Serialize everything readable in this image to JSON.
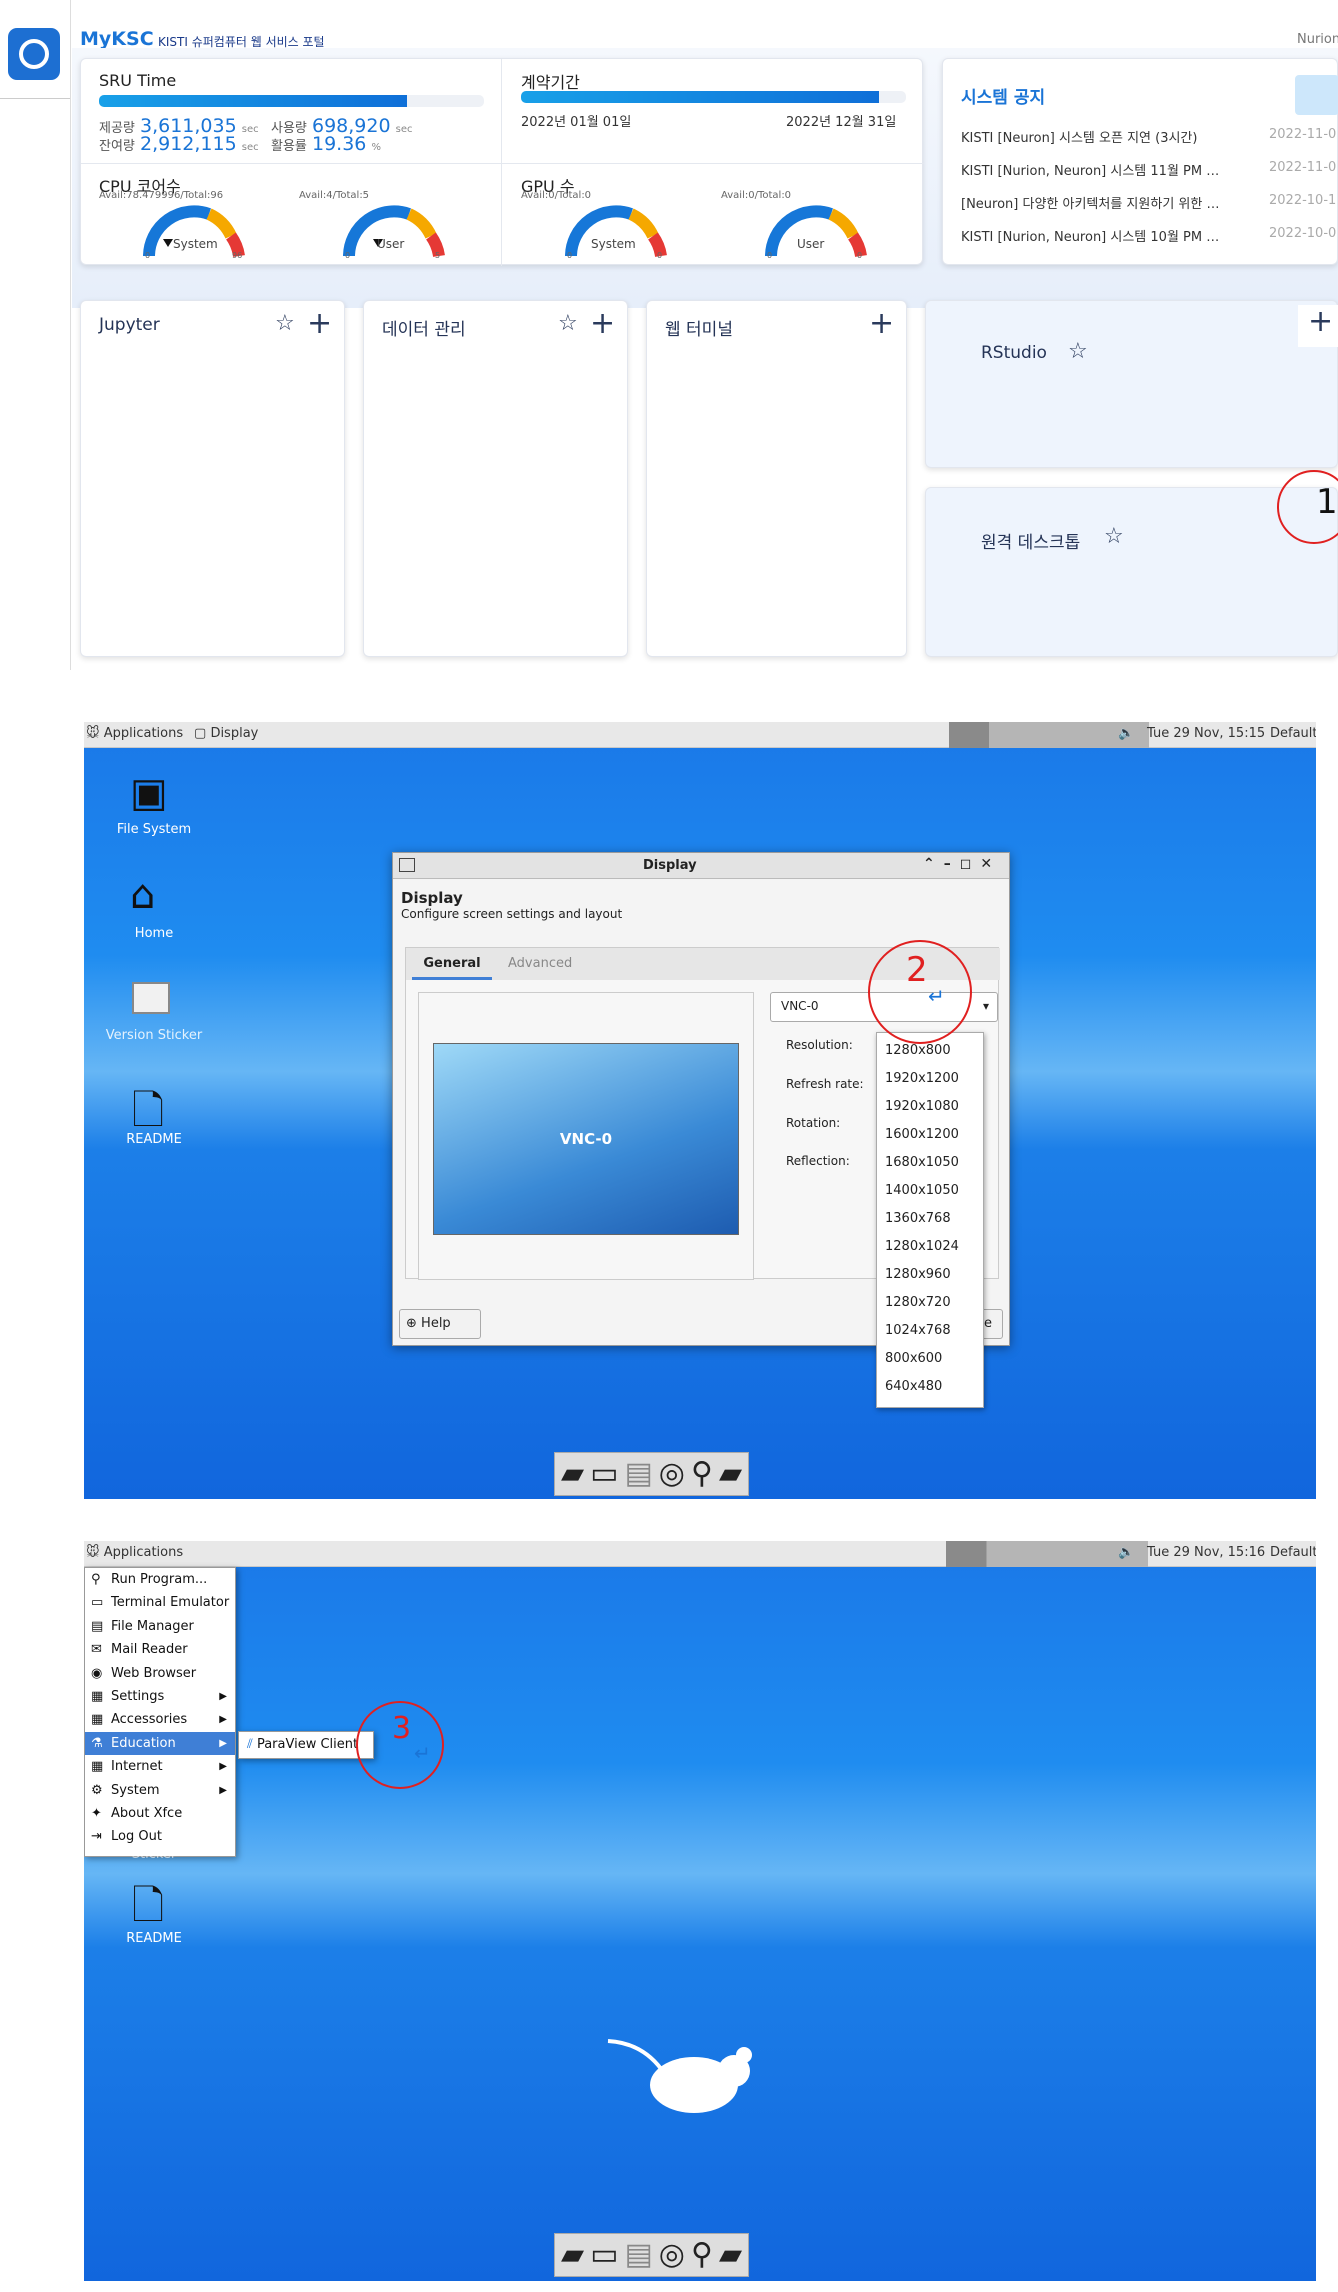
{
  "portal": {
    "brand": "MyKSC",
    "subtitle": "KISTI 슈퍼컴퓨터 웹 서비스 포털",
    "top_right": "Nurion",
    "sru": {
      "title": "SRU Time",
      "progress": 0.8,
      "provided_label": "제공량",
      "provided_value": "3,611,035",
      "provided_unit": "sec",
      "used_label": "사용량",
      "used_value": "698,920",
      "used_unit": "sec",
      "remain_label": "잔여량",
      "remain_value": "2,912,115",
      "remain_unit": "sec",
      "rate_label": "활용률",
      "rate_value": "19.36",
      "rate_unit": "%"
    },
    "contract": {
      "title": "계약기간",
      "progress": 0.93,
      "start": "2022년 01월 01일",
      "end": "2022년 12월 31일"
    },
    "cpu": {
      "title": "CPU 코어수",
      "system_avail": "Avail:78.479996/Total:96",
      "system_label": "System",
      "system_min": "0",
      "system_max": "96",
      "user_avail": "Avail:4/Total:5",
      "user_label": "User",
      "user_min": "0",
      "user_max": "5"
    },
    "gpu": {
      "title": "GPU 수",
      "system_avail": "Avail:0/Total:0",
      "system_label": "System",
      "system_min": "0",
      "system_max": "0",
      "user_avail": "Avail:0/Total:0",
      "user_label": "User",
      "user_min": "0",
      "user_max": "0"
    },
    "notice": {
      "title": "시스템 공지",
      "items": [
        {
          "text": "KISTI [Neuron] 시스템 오픈 지연 (3시간)",
          "date": "2022-11-0"
        },
        {
          "text": "KISTI [Nurion, Neuron] 시스템 11월 PM …",
          "date": "2022-11-0"
        },
        {
          "text": "[Neuron] 다양한 아키텍처를 지원하기 위한 …",
          "date": "2022-10-1"
        },
        {
          "text": "KISTI [Nurion, Neuron] 시스템 10월 PM …",
          "date": "2022-10-0"
        }
      ]
    },
    "apps": {
      "jupyter": "Jupyter",
      "data": "데이터 관리",
      "terminal": "웹 터미널",
      "rstudio": "RStudio",
      "remote": "원격 데스크톱"
    },
    "step1": "1"
  },
  "desktop1": {
    "applications": "Applications",
    "window_tab": "Display",
    "clock": "Tue 29 Nov, 15:15",
    "default": "Default",
    "icons": {
      "filesystem": "File System",
      "home": "Home",
      "version_sticker": "Version Sticker",
      "readme": "README"
    },
    "dialog": {
      "title": "Display",
      "heading": "Display",
      "description": "Configure screen settings and layout",
      "tab_general": "General",
      "tab_advanced": "Advanced",
      "monitor_name": "VNC-0",
      "select_value": "VNC-0",
      "resolution_label": "Resolution:",
      "refresh_label": "Refresh rate:",
      "rotation_label": "Rotation:",
      "reflection_label": "Reflection:",
      "help": "Help",
      "close_fragment": "e",
      "resolutions": [
        "1280x800",
        "1920x1200",
        "1920x1080",
        "1600x1200",
        "1680x1050",
        "1400x1050",
        "1360x768",
        "1280x1024",
        "1280x960",
        "1280x720",
        "1024x768",
        "800x600",
        "640x480"
      ]
    },
    "step2": "2"
  },
  "desktop2": {
    "applications": "Applications",
    "clock": "Tue 29 Nov, 15:16",
    "default": "Default",
    "menu": [
      {
        "label": "Run Program...",
        "icon": "⚲",
        "arrow": ""
      },
      {
        "label": "Terminal Emulator",
        "icon": "▭",
        "arrow": ""
      },
      {
        "label": "File Manager",
        "icon": "▤",
        "arrow": ""
      },
      {
        "label": "Mail Reader",
        "icon": "✉",
        "arrow": ""
      },
      {
        "label": "Web Browser",
        "icon": "◉",
        "arrow": ""
      },
      {
        "label": "Settings",
        "icon": "▦",
        "arrow": "▶"
      },
      {
        "label": "Accessories",
        "icon": "▦",
        "arrow": "▶"
      },
      {
        "label": "Education",
        "icon": "⚗",
        "arrow": "▶"
      },
      {
        "label": "Internet",
        "icon": "▦",
        "arrow": "▶"
      },
      {
        "label": "System",
        "icon": "⚙",
        "arrow": "▶"
      },
      {
        "label": "About Xfce",
        "icon": "✦",
        "arrow": ""
      },
      {
        "label": "Log Out",
        "icon": "⇥",
        "arrow": ""
      }
    ],
    "submenu_item": "ParaView Client",
    "sticker_fragment": "Sticker",
    "readme": "README",
    "step3": "3"
  },
  "colors": {
    "brand_blue": "#1a74d6",
    "annotation_red": "#e02020",
    "desktop_blue": "#1a78e8"
  }
}
